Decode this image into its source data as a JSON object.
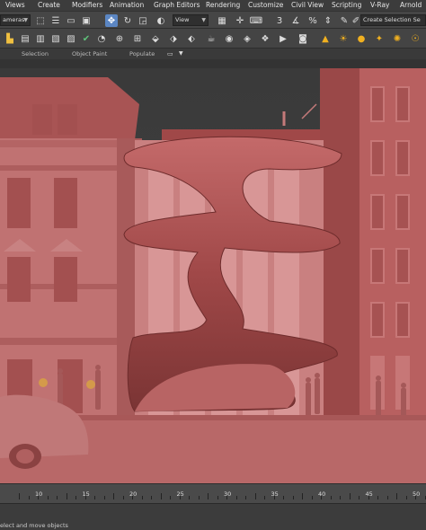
{
  "menu": [
    "Views",
    "Create",
    "Modifiers",
    "Animation",
    "Graph Editors",
    "Rendering",
    "Customize",
    "Civil View",
    "Scripting",
    "V-Ray",
    "Arnold"
  ],
  "toolbar": {
    "view_dropdown": "View",
    "named_selection": "Create Selection Se",
    "cameras_dropdown": "ameras"
  },
  "ribbon": {
    "tabs": [
      "Selection",
      "Object Paint",
      "Populate"
    ]
  },
  "timeline": {
    "ticks": [
      "10",
      "15",
      "20",
      "25",
      "30",
      "35",
      "40",
      "45",
      "50"
    ]
  },
  "status": {
    "prompt": "elect and move objects"
  },
  "colors": {
    "clay": "#b45f5f",
    "clay_dark": "#8a4040",
    "background": "#3a3a3a",
    "select_blue": "#5b86c3"
  }
}
